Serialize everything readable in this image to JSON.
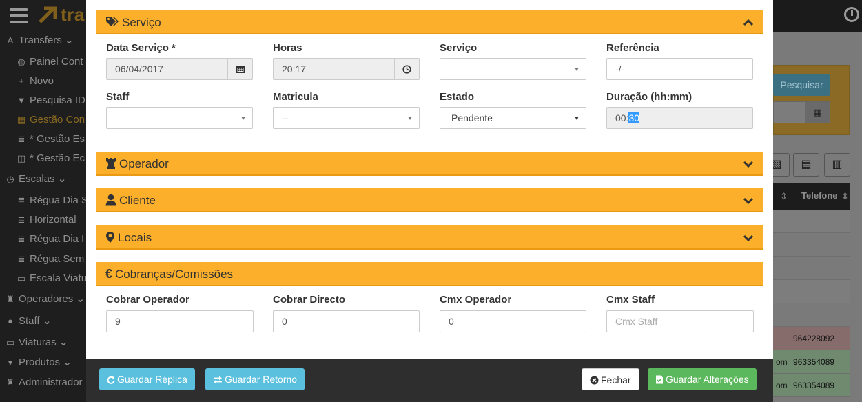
{
  "background": {
    "brand": "tra",
    "sidebar": [
      {
        "label": "Transfers",
        "icon": "road-icon",
        "level": "top",
        "chevron": true
      },
      {
        "label": "Painel Cont",
        "icon": "dashboard-icon",
        "level": "sub"
      },
      {
        "label": "Novo",
        "icon": "plus-icon",
        "level": "sub"
      },
      {
        "label": "Pesquisa ID",
        "icon": "filter-icon",
        "level": "sub"
      },
      {
        "label": "Gestão Con",
        "icon": "table-icon",
        "level": "sub",
        "active": true
      },
      {
        "label": "* Gestão Es",
        "icon": "list-icon",
        "level": "sub"
      },
      {
        "label": "* Gestão Ec",
        "icon": "columns-icon",
        "level": "sub"
      },
      {
        "label": "Escalas",
        "icon": "clock-icon",
        "level": "top",
        "chevron": true
      },
      {
        "label": "Régua Dia S",
        "icon": "list-icon",
        "level": "sub"
      },
      {
        "label": "Horizontal",
        "icon": "list-icon",
        "level": "sub"
      },
      {
        "label": "Régua Dia I",
        "icon": "list-icon",
        "level": "sub"
      },
      {
        "label": "Régua Sem",
        "icon": "list-icon",
        "level": "sub"
      },
      {
        "label": "Escala Viatu",
        "icon": "car-icon",
        "level": "sub"
      },
      {
        "label": "Operadores",
        "icon": "chess-icon",
        "level": "top",
        "chevron": true
      },
      {
        "label": "Staff",
        "icon": "user-icon",
        "level": "top",
        "chevron": true
      },
      {
        "label": "Viaturas",
        "icon": "car-icon",
        "level": "top",
        "chevron": true
      },
      {
        "label": "Produtos",
        "icon": "cart-icon",
        "level": "top",
        "chevron": true
      },
      {
        "label": "Administrador",
        "icon": "chess-icon",
        "level": "top"
      }
    ],
    "search_button": "Pesquisar",
    "table_header": "Telefone",
    "table_rows": [
      {
        "phone": "",
        "color": "#7d7d7d"
      },
      {
        "phone": "",
        "color": "#7a7a7a"
      },
      {
        "phone": "",
        "color": "#7a7a7a"
      },
      {
        "phone": "",
        "color": "#7d7d7d"
      },
      {
        "phone": "",
        "color": "#7a7a7a"
      },
      {
        "phone": "964228092",
        "color": "#876c6c"
      },
      {
        "phone": "963354089",
        "prefix": "om",
        "color": "#6f8a6f"
      },
      {
        "phone": "963354089",
        "prefix": "om",
        "color": "#6f8a6f"
      }
    ]
  },
  "modal": {
    "sections": {
      "servico": {
        "title": "Serviço",
        "icon": "tags-icon",
        "expanded": true
      },
      "operador": {
        "title": "Operador",
        "icon": "chess-rook-icon",
        "expanded": false
      },
      "cliente": {
        "title": "Cliente",
        "icon": "user-icon",
        "expanded": false
      },
      "locais": {
        "title": "Locais",
        "icon": "map-marker-icon",
        "expanded": false
      },
      "cobrancas": {
        "title": "Cobranças/Comissões",
        "icon": "euro-icon",
        "expanded": true
      }
    },
    "servico_fields": {
      "data_servico": {
        "label": "Data Serviço *",
        "value": "06/04/2017"
      },
      "horas": {
        "label": "Horas",
        "value": "20:17"
      },
      "servico": {
        "label": "Serviço",
        "value": ""
      },
      "referencia": {
        "label": "Referência",
        "value": "-/-"
      },
      "staff": {
        "label": "Staff",
        "value": ""
      },
      "matricula": {
        "label": "Matricula",
        "value": "--"
      },
      "estado": {
        "label": "Estado",
        "value": "Pendente"
      },
      "duracao": {
        "label": "Duração (hh:mm)",
        "value_prefix": "00:",
        "value_selected": "30"
      }
    },
    "cobrancas_fields": {
      "cobrar_operador": {
        "label": "Cobrar Operador",
        "value": "9"
      },
      "cobrar_directo": {
        "label": "Cobrar Directo",
        "value": "0"
      },
      "cmx_operador": {
        "label": "Cmx Operador",
        "value": "0"
      },
      "cmx_staff": {
        "label": "Cmx Staff",
        "value": "",
        "placeholder": "Cmx Staff"
      }
    },
    "footer": {
      "guardar_replica": "Guardar Réplica",
      "guardar_retorno": "Guardar Retorno",
      "fechar": "Fechar",
      "guardar_alteracoes": "Guardar Alterações"
    }
  },
  "colors": {
    "accordion": "#fcaf2a",
    "info": "#5bc0de",
    "success": "#5cb85c",
    "footer": "#2e2e2e"
  }
}
